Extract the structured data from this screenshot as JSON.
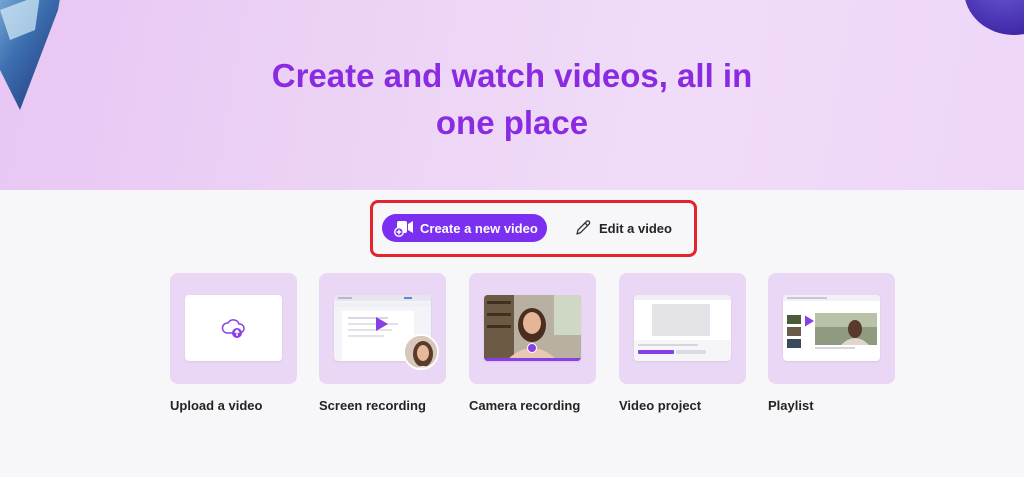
{
  "hero": {
    "title_line1": "Create and watch videos, all in",
    "title_line2": "one place"
  },
  "actions": {
    "create_label": "Create a new video",
    "create_icon": "video-add-icon",
    "edit_label": "Edit a video",
    "edit_icon": "pencil-icon"
  },
  "cards": [
    {
      "label": "Upload a video",
      "icon": "cloud-upload-icon"
    },
    {
      "label": "Screen recording",
      "icon": "screen-record-icon"
    },
    {
      "label": "Camera recording",
      "icon": "camera-icon"
    },
    {
      "label": "Video project",
      "icon": "video-project-icon"
    },
    {
      "label": "Playlist",
      "icon": "playlist-icon"
    }
  ],
  "colors": {
    "accent": "#7b2ff0",
    "title": "#8a2be2",
    "card_bg": "#ead7f5",
    "highlight_border": "#e5232d"
  }
}
